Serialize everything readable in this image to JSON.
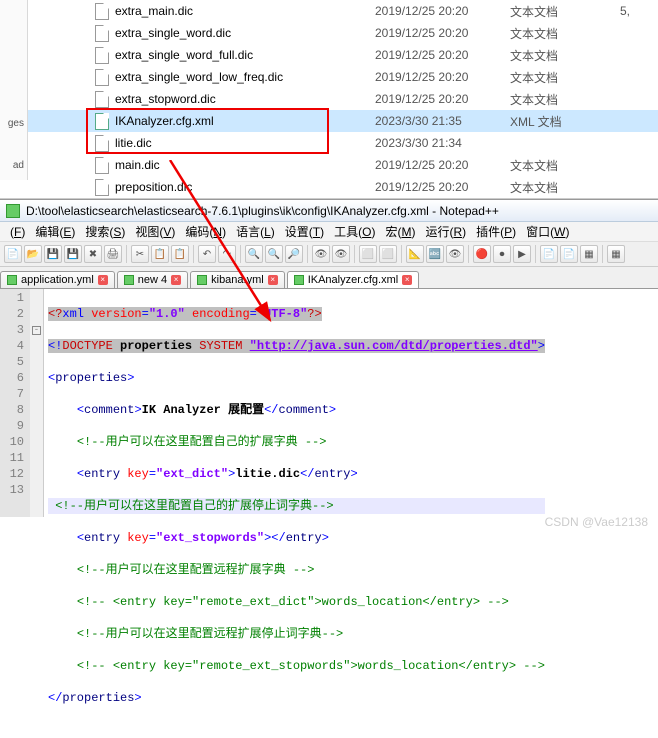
{
  "explorer": {
    "sidebar": [
      "ges",
      "ad"
    ],
    "files": [
      {
        "name": "extra_main.dic",
        "date": "2019/12/25 20:20",
        "type": "文本文档",
        "size": "5,"
      },
      {
        "name": "extra_single_word.dic",
        "date": "2019/12/25 20:20",
        "type": "文本文档",
        "size": ""
      },
      {
        "name": "extra_single_word_full.dic",
        "date": "2019/12/25 20:20",
        "type": "文本文档",
        "size": ""
      },
      {
        "name": "extra_single_word_low_freq.dic",
        "date": "2019/12/25 20:20",
        "type": "文本文档",
        "size": ""
      },
      {
        "name": "extra_stopword.dic",
        "date": "2019/12/25 20:20",
        "type": "文本文档",
        "size": ""
      },
      {
        "name": "IKAnalyzer.cfg.xml",
        "date": "2023/3/30 21:35",
        "type": "XML 文档",
        "size": "",
        "selected": true,
        "icon": "xml"
      },
      {
        "name": "litie.dic",
        "date": "2023/3/30 21:34",
        "type": "",
        "size": ""
      },
      {
        "name": "main.dic",
        "date": "2019/12/25 20:20",
        "type": "文本文档",
        "size": ""
      },
      {
        "name": "preposition.dic",
        "date": "2019/12/25 20:20",
        "type": "文本文档",
        "size": ""
      }
    ]
  },
  "npp": {
    "title": "D:\\tool\\elasticsearch\\elasticsearch-7.6.1\\plugins\\ik\\config\\IKAnalyzer.cfg.xml - Notepad++",
    "menu": [
      {
        "label": "(",
        "u": "F",
        "suffix": ")"
      },
      {
        "label": "编辑(",
        "u": "E",
        "suffix": ")"
      },
      {
        "label": "搜索(",
        "u": "S",
        "suffix": ")"
      },
      {
        "label": "视图(",
        "u": "V",
        "suffix": ")"
      },
      {
        "label": "编码(",
        "u": "N",
        "suffix": ")"
      },
      {
        "label": "语言(",
        "u": "L",
        "suffix": ")"
      },
      {
        "label": "设置(",
        "u": "T",
        "suffix": ")"
      },
      {
        "label": "工具(",
        "u": "O",
        "suffix": ")"
      },
      {
        "label": "宏(",
        "u": "M",
        "suffix": ")"
      },
      {
        "label": "运行(",
        "u": "R",
        "suffix": ")"
      },
      {
        "label": "插件(",
        "u": "P",
        "suffix": ")"
      },
      {
        "label": "窗口(",
        "u": "W",
        "suffix": ")"
      }
    ],
    "tabs": [
      {
        "label": "application.yml"
      },
      {
        "label": "new 4"
      },
      {
        "label": "kibana.yml"
      },
      {
        "label": "IKAnalyzer.cfg.xml",
        "active": true
      }
    ],
    "lines": [
      1,
      2,
      3,
      4,
      5,
      6,
      7,
      8,
      9,
      10,
      11,
      12,
      13
    ],
    "fold": [
      "",
      "",
      "-",
      "",
      "",
      "",
      "",
      "",
      "",
      "",
      "",
      "",
      ""
    ],
    "tokens": {
      "l1_pi_open": "<?",
      "l1_kw": "xml",
      "l1_a1": " version",
      "l1_eq": "=",
      "l1_v1": "\"1.0\"",
      "l1_a2": " encoding",
      "l1_v2": "\"UTF-8\"",
      "l1_pi_close": "?>",
      "l2_dt_open": "<!",
      "l2_dt": "DOCTYPE",
      "l2_prop": " properties ",
      "l2_sys": "SYSTEM ",
      "l2_url": "\"http://java.sun.com/dtd/properties.dtd\"",
      "l2_close": ">",
      "l3_open": "<",
      "l3_tag": "properties",
      "l3_close": ">",
      "l4_open": "<",
      "l4_tag": "comment",
      "l4_close": ">",
      "l4_txt1": "IK Analyzer ",
      "l4_txt2": "展配置",
      "l4_c_open": "</",
      "l4_c_close": ">",
      "l5_cmt": "<!--用户可以在这里配置自己的扩展字典 -->",
      "l6_open": "<",
      "l6_tag": "entry",
      "l6_attr": " key",
      "l6_eq": "=",
      "l6_val": "\"ext_dict\"",
      "l6_close": ">",
      "l6_txt": "litie.dic",
      "l6_c_open": "</",
      "l6_c_close": ">",
      "l7_cmt": " <!--用户可以在这里配置自己的扩展停止词字典-->",
      "l8_open": "<",
      "l8_tag": "entry",
      "l8_attr": " key",
      "l8_val": "\"ext_stopwords\"",
      "l8_close": ">",
      "l8_c_open": "</",
      "l8_c_close": ">",
      "l9_cmt": "<!--用户可以在这里配置远程扩展字典 -->",
      "l10_cmt": "<!-- <entry key=\"remote_ext_dict\">words_location</entry> -->",
      "l11_cmt": "<!--用户可以在这里配置远程扩展停止词字典-->",
      "l12_cmt": "<!-- <entry key=\"remote_ext_stopwords\">words_location</entry> -->",
      "l13_open": "</",
      "l13_tag": "properties",
      "l13_close": ">"
    }
  },
  "watermark": "CSDN @Vae12138"
}
